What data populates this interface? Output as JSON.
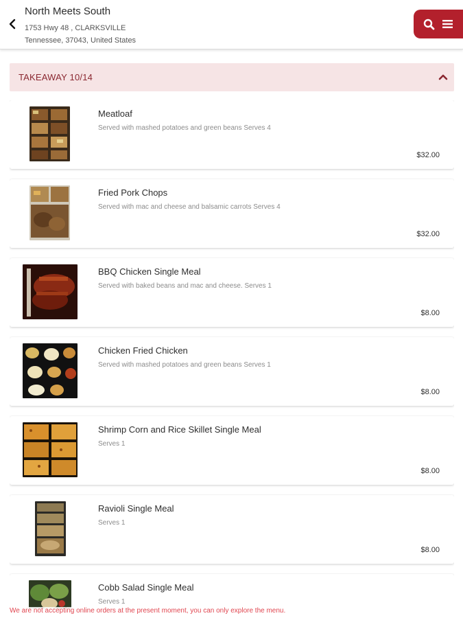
{
  "header": {
    "restaurant_name": "North Meets South",
    "address_line1": "1753 Hwy 48 , CLARKSVILLE",
    "address_line2": "Tennessee, 37043, United States",
    "back_icon": "chevron-left-icon",
    "search_icon": "search-icon",
    "menu_icon": "hamburger-menu-icon",
    "accent_color": "#b3202c"
  },
  "category": {
    "title": "TAKEAWAY 10/14",
    "expanded": true,
    "chevron_icon": "chevron-up-icon",
    "background_color": "#f6e4e5"
  },
  "items": [
    {
      "name": "Meatloaf",
      "description": "Served with mashed potatoes and green beans Serves 4",
      "price": "$32.00"
    },
    {
      "name": "Fried Pork Chops",
      "description": "Served with mac and cheese and balsamic carrots Serves 4",
      "price": "$32.00"
    },
    {
      "name": "BBQ Chicken Single Meal",
      "description": "Served with baked beans and mac and cheese. Serves 1",
      "price": "$8.00"
    },
    {
      "name": "Chicken Fried Chicken",
      "description": "Served with mashed potatoes and green beans Serves 1",
      "price": "$8.00"
    },
    {
      "name": "Shrimp Corn and Rice Skillet Single Meal",
      "description": "Serves 1",
      "price": "$8.00"
    },
    {
      "name": "Ravioli Single Meal",
      "description": "Serves 1",
      "price": "$8.00"
    },
    {
      "name": "Cobb Salad Single Meal",
      "description": "Serves 1",
      "price": ""
    }
  ],
  "footer": {
    "notice": "We are not accepting online orders at the present moment, you can only explore the menu.",
    "notice_color": "#e0454f"
  }
}
